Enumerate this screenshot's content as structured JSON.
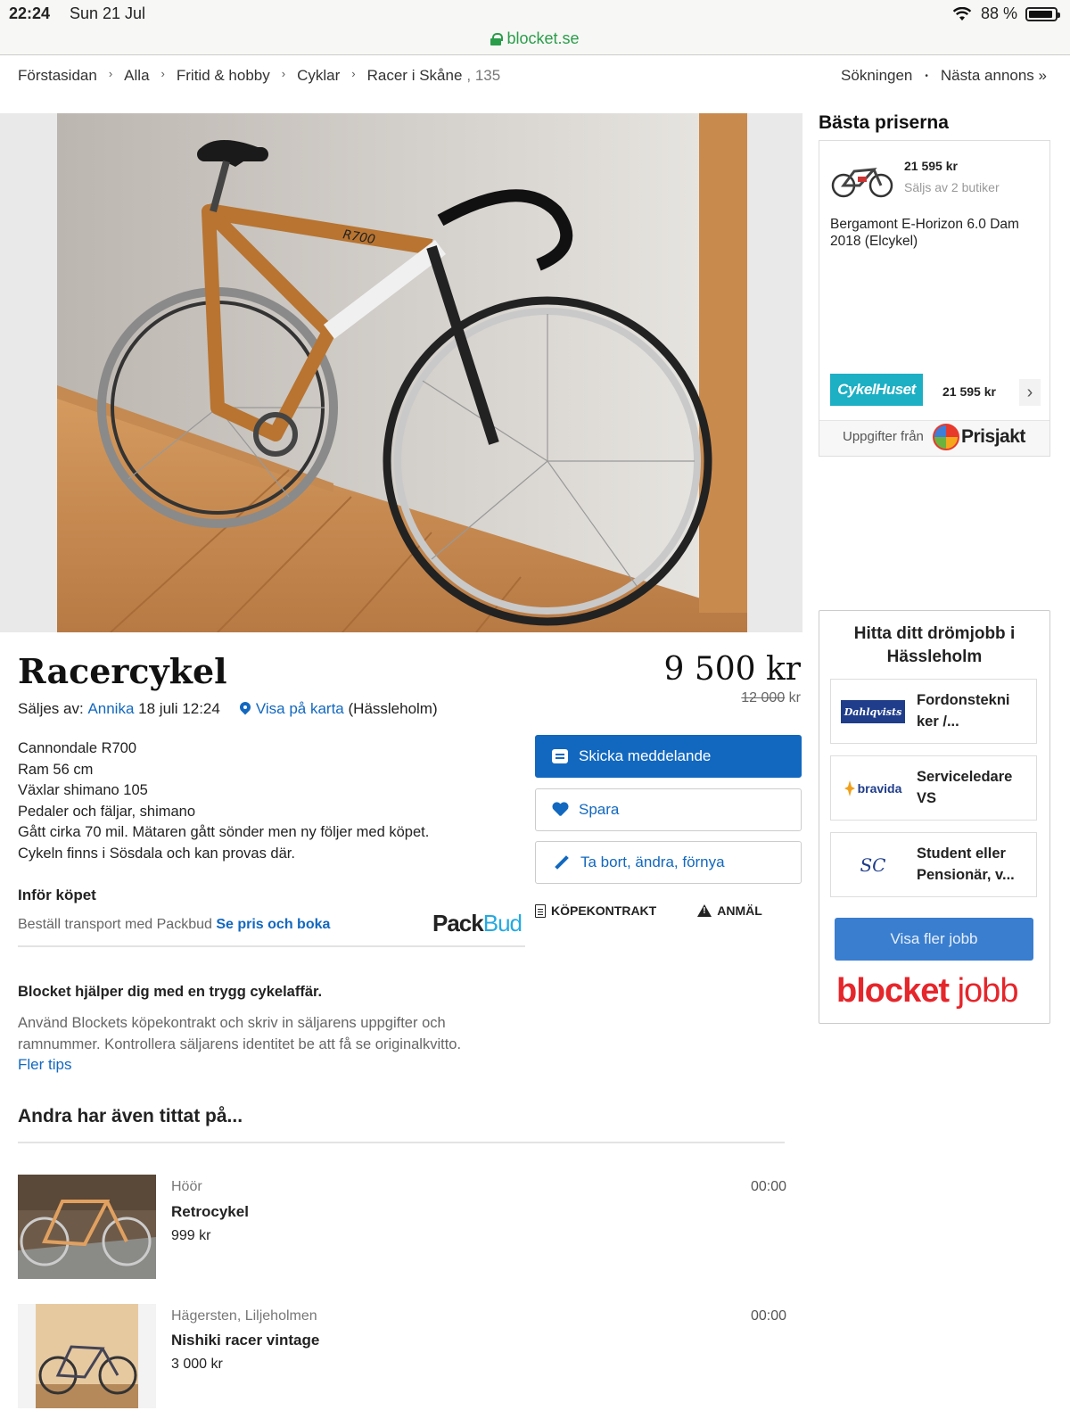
{
  "status_bar": {
    "time": "22:24",
    "date": "Sun 21 Jul",
    "battery": "88 %"
  },
  "browser": {
    "url": "blocket.se"
  },
  "breadcrumb": {
    "items": [
      "Förstasidan",
      "Alla",
      "Fritid & hobby",
      "Cyklar",
      "Racer i Skåne"
    ],
    "count": ", 135"
  },
  "top_nav": {
    "search": "Sökningen",
    "next": "Nästa annons »"
  },
  "listing": {
    "title": "Racercykel",
    "price": "9 500 kr",
    "old_price_value": "12 000",
    "old_price_unit": "kr",
    "seller_prefix": "Säljes av:",
    "seller_name": "Annika",
    "date": "18 juli 12:24",
    "map_link": "Visa på karta",
    "location": "(Hässleholm)",
    "description": [
      "Cannondale R700",
      "Ram 56 cm",
      "Växlar shimano 105",
      "Pedaler och fäljar, shimano",
      "Gått cirka 70 mil. Mätaren gått sönder men ny följer med köpet.",
      "Cykeln finns i Sösdala och kan provas där."
    ]
  },
  "purchase": {
    "heading": "Inför köpet",
    "packbud_text": "Beställ transport med Packbud",
    "packbud_link": "Se pris och boka",
    "packbud_logo_a": "Pack",
    "packbud_logo_b": "Bud"
  },
  "actions": {
    "message": "Skicka meddelande",
    "save": "Spara",
    "edit": "Ta bort, ändra, förnya",
    "contract": "KÖPEKONTRAKT",
    "report": "ANMÄL"
  },
  "safety": {
    "heading": "Blocket hjälper dig med en trygg cykelaffär.",
    "text": "Använd Blockets köpekontrakt och skriv in säljarens uppgifter och ramnummer. Kontrollera säljarens identitet be att få se originalkvitto.",
    "link": "Fler tips"
  },
  "related": {
    "heading": "Andra har även tittat på...",
    "items": [
      {
        "location": "Höör",
        "title": "Retrocykel",
        "price": "999 kr",
        "time": "00:00"
      },
      {
        "location": "Hägersten, Liljeholmen",
        "title": "Nishiki racer vintage",
        "price": "3 000 kr",
        "time": "00:00"
      }
    ]
  },
  "best_prices": {
    "heading": "Bästa priserna",
    "price": "21 595 kr",
    "shops": "Säljs av 2 butiker",
    "product": "Bergamont E-Horizon 6.0 Dam 2018 (Elcykel)",
    "shop_logo": "CykelHuset",
    "shop_price": "21 595 kr",
    "source_prefix": "Uppgifter från",
    "source": "Prisjakt"
  },
  "jobs": {
    "heading": "Hitta ditt drömjobb i Hässleholm",
    "items": [
      {
        "title": "Fordonstekni ker /...",
        "logo": "Dahlqvists"
      },
      {
        "title": "Serviceledare VS",
        "logo": "bravida"
      },
      {
        "title": "Student eller Pensionär, v...",
        "logo": "SC"
      }
    ],
    "more_button": "Visa fler jobb",
    "brand_a": "blocket",
    "brand_b": "jobb"
  },
  "colors": {
    "link": "#1268bf",
    "primary_button": "#1268bf",
    "secure": "#2a9d4a",
    "blocket_red": "#e5262b"
  }
}
